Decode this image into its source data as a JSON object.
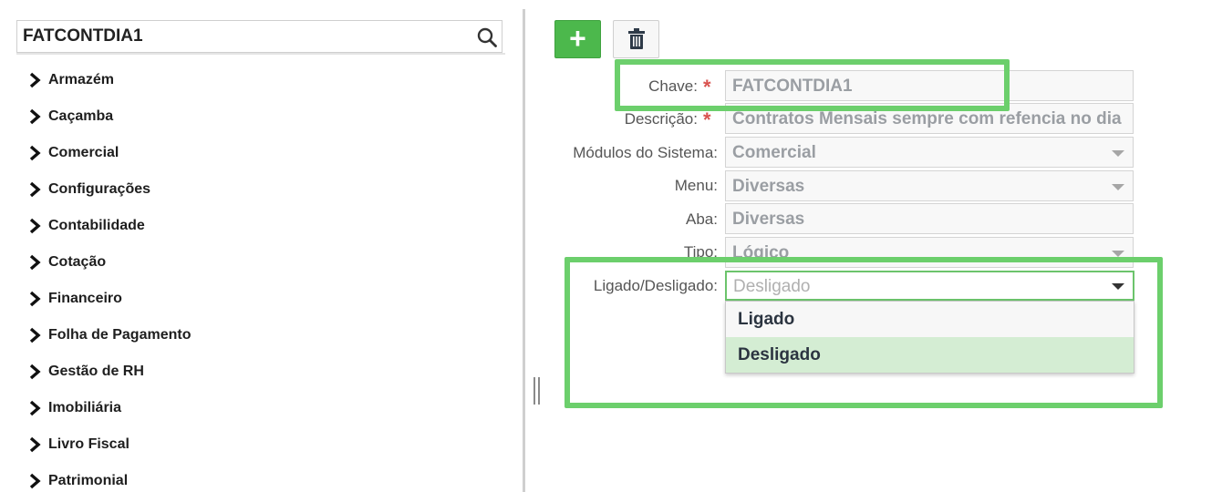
{
  "search": {
    "value": "FATCONTDIA1",
    "icon": "search-icon"
  },
  "tree": {
    "items": [
      {
        "label": "Armazém"
      },
      {
        "label": "Caçamba"
      },
      {
        "label": "Comercial"
      },
      {
        "label": "Configurações"
      },
      {
        "label": "Contabilidade"
      },
      {
        "label": "Cotação"
      },
      {
        "label": "Financeiro"
      },
      {
        "label": "Folha de Pagamento"
      },
      {
        "label": "Gestão de RH"
      },
      {
        "label": "Imobiliária"
      },
      {
        "label": "Livro Fiscal"
      },
      {
        "label": "Patrimonial"
      }
    ]
  },
  "toolbar": {
    "add_label": "+",
    "add_color": "#4cb84c",
    "delete_icon": "trash-icon"
  },
  "form": {
    "required_mark": "*",
    "chave": {
      "label": "Chave:",
      "value": "FATCONTDIA1"
    },
    "descricao": {
      "label": "Descrição:",
      "value": "Contratos Mensais sempre com refencia no dia"
    },
    "modulos": {
      "label": "Módulos do Sistema:",
      "value": "Comercial"
    },
    "menu": {
      "label": "Menu:",
      "value": "Diversas"
    },
    "aba": {
      "label": "Aba:",
      "value": "Diversas"
    },
    "tipo": {
      "label": "Tipo:",
      "value": "Lógico"
    },
    "ligado": {
      "label": "Ligado/Desligado:",
      "value": "Desligado",
      "options": [
        "Ligado",
        "Desligado"
      ],
      "selected": "Desligado"
    }
  },
  "highlight_color": "#6ccf6c"
}
